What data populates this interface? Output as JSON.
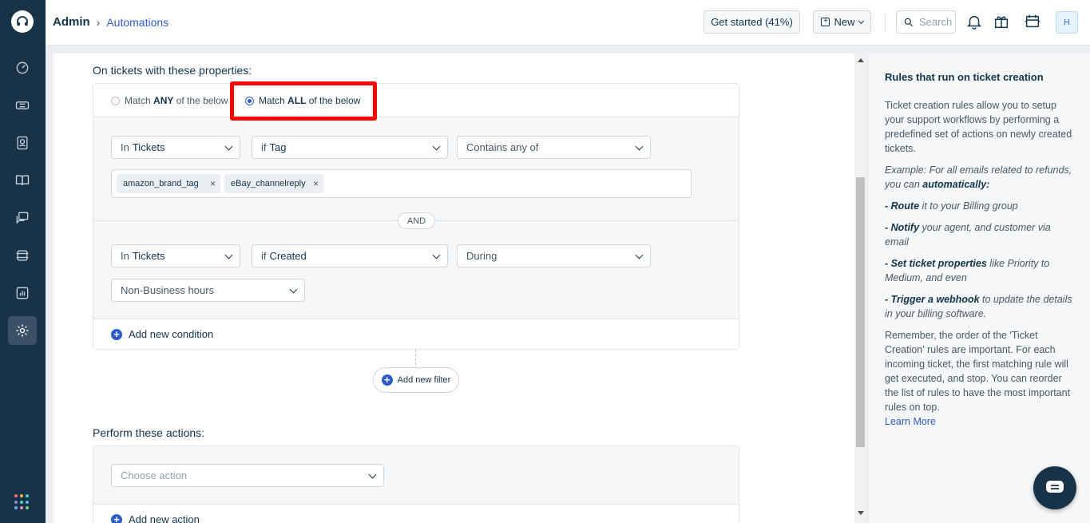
{
  "header": {
    "breadcrumb_root": "Admin",
    "breadcrumb_sep": "›",
    "breadcrumb_current": "Automations",
    "get_started": "Get started (41%)",
    "new_label": "New",
    "search_placeholder": "Search",
    "avatar_initial": "H"
  },
  "conditions": {
    "title": "On tickets with these properties:",
    "match_any_prefix": "Match",
    "match_any_bold": "ANY",
    "match_any_suffix": "of the below",
    "match_all_prefix": "Match",
    "match_all_bold": "ALL",
    "match_all_suffix": "of the below",
    "selected": "all",
    "group1": {
      "in_prefix": "In",
      "in_value": "Tickets",
      "if_prefix": "if",
      "if_value": "Tag",
      "operator": "Contains any of",
      "tags": [
        "amazon_brand_tag",
        "eBay_channelreply"
      ]
    },
    "and_label": "AND",
    "group2": {
      "in_prefix": "In",
      "in_value": "Tickets",
      "if_prefix": "if",
      "if_value": "Created",
      "operator": "During",
      "value": "Non-Business hours"
    },
    "add_condition": "Add new condition",
    "add_filter": "Add new filter"
  },
  "actions": {
    "title": "Perform these actions:",
    "choose_placeholder": "Choose action",
    "add_action": "Add new action"
  },
  "help": {
    "title": "Rules that run on ticket creation",
    "intro": "Ticket creation rules allow you to setup your support workflows by performing a predefined set of actions on newly created tickets.",
    "example_prefix": "Example: For all emails related to refunds, you can ",
    "example_bold": "automatically:",
    "items": [
      {
        "bold": "- Route",
        "rest": " it to your Billing group"
      },
      {
        "bold": "- Notify",
        "rest": " your agent, and customer via email"
      },
      {
        "bold": "- Set ticket properties",
        "rest": " like Priority to Medium, and even"
      },
      {
        "bold": "- Trigger a webhook",
        "rest": " to update the details in your billing software."
      }
    ],
    "note": "Remember, the order of the 'Ticket Creation' rules are important. For each incoming ticket, the first matching rule will get executed, and stop. You can reorder the list of rules to have the most important rules on top.",
    "learn_more": "Learn More"
  },
  "colors": {
    "sidebar": "#183247",
    "accent": "#2c5cc5",
    "highlight": "#ff0000"
  }
}
